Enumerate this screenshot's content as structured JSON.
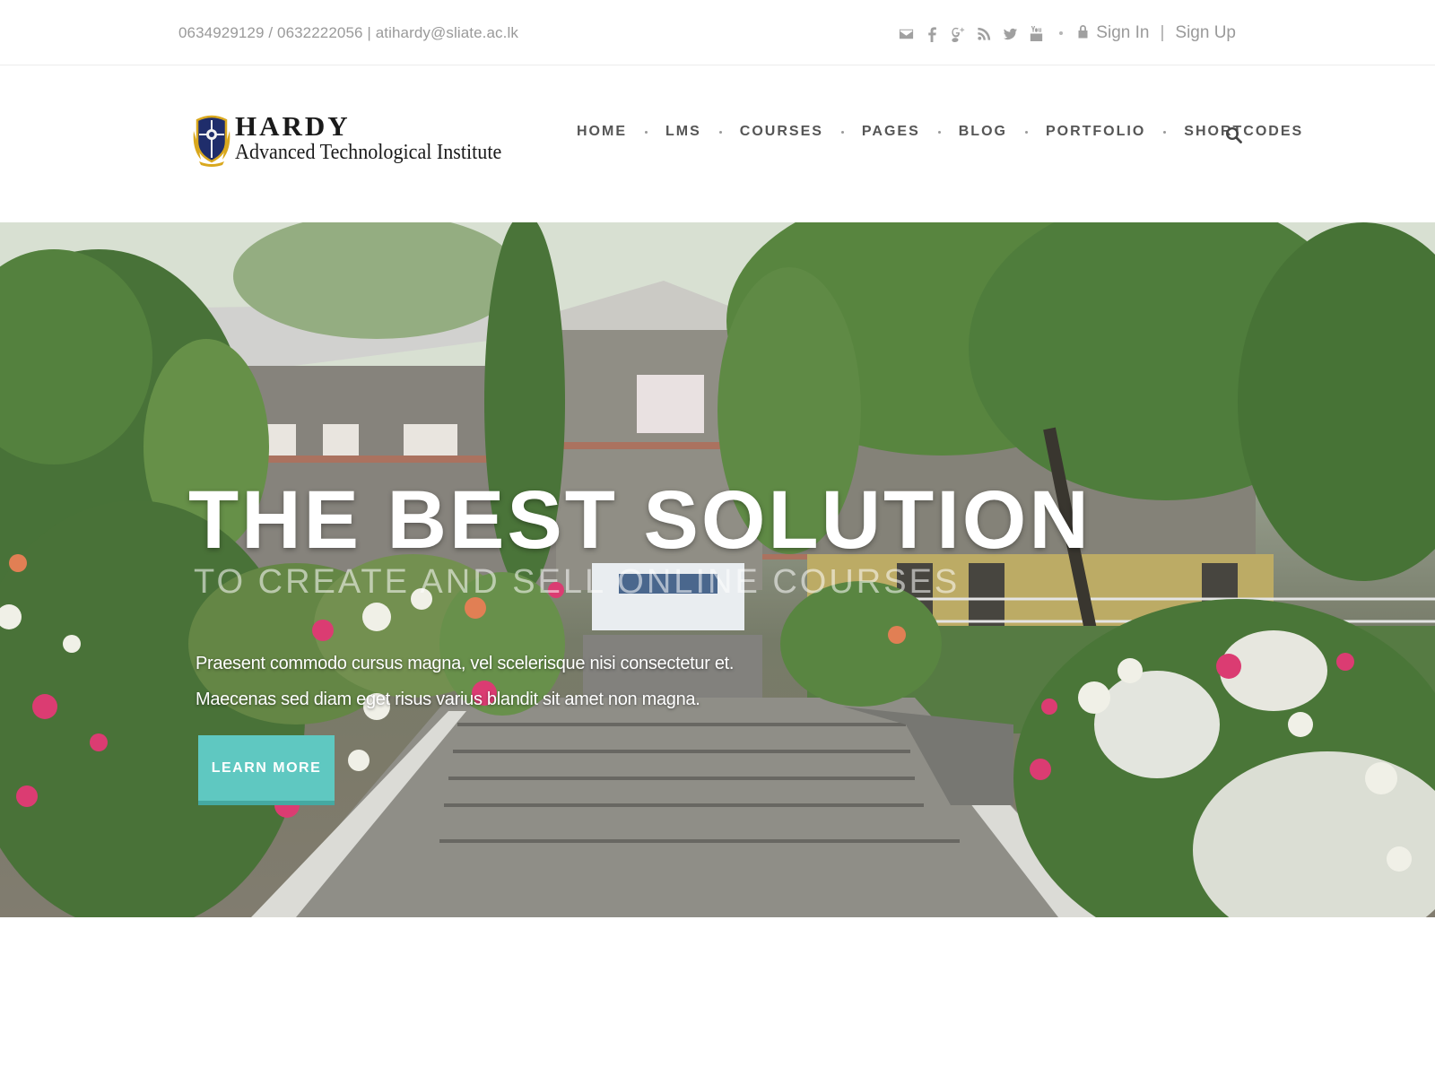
{
  "topbar": {
    "contact": "0634929129 / 0632222056 | atihardy@sliate.ac.lk",
    "social_icons": [
      "mail-icon",
      "facebook-icon",
      "google-plus-icon",
      "rss-icon",
      "twitter-icon",
      "youtube-icon"
    ],
    "sign_in": "Sign In",
    "separator": "|",
    "sign_up": "Sign Up"
  },
  "header": {
    "logo": {
      "name": "HARDY",
      "subtitle": "Advanced Technological Institute"
    },
    "nav": {
      "items": [
        {
          "label": "HOME"
        },
        {
          "label": "LMS"
        },
        {
          "label": "COURSES"
        },
        {
          "label": "PAGES"
        },
        {
          "label": "BLOG"
        },
        {
          "label": "PORTFOLIO"
        },
        {
          "label": "SHORTCODES"
        }
      ]
    },
    "search_icon": "search-icon"
  },
  "hero": {
    "title": "THE BEST SOLUTION",
    "subtitle": "TO CREATE AND SELL ONLINE COURSES",
    "description_line1": "Praesent commodo cursus magna, vel scelerisque nisi consectetur et.",
    "description_line2": "Maecenas sed diam eget risus varius blandit sit amet non magna.",
    "cta_label": "LEARN MORE"
  },
  "colors": {
    "accent": "#5fc8c1",
    "accent_dark": "#45a9a2",
    "muted_text": "#9a9a9a",
    "nav_text": "#555555"
  }
}
